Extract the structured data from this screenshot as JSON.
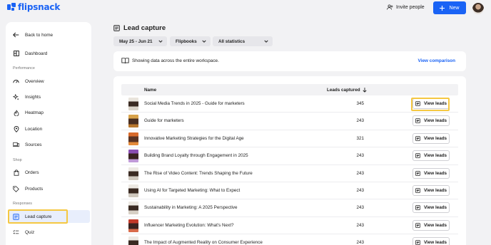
{
  "app": {
    "logo_text": "flipsnack",
    "brand_color": "#1a63f5",
    "highlight_color": "#f5c842"
  },
  "header": {
    "invite_label": "Invite people",
    "new_label": "New"
  },
  "sidebar": {
    "back_label": "Back to home",
    "dashboard_label": "Dashboard",
    "sections": {
      "performance": "Performance",
      "shop": "Shop",
      "responses": "Responses"
    },
    "items": [
      {
        "label": "Overview",
        "icon": "gauge-icon"
      },
      {
        "label": "Insights",
        "icon": "sparkle-icon"
      },
      {
        "label": "Heatmap",
        "icon": "flame-icon"
      },
      {
        "label": "Location",
        "icon": "pin-icon"
      },
      {
        "label": "Sources",
        "icon": "devices-icon"
      },
      {
        "label": "Orders",
        "icon": "bag-icon"
      },
      {
        "label": "Products",
        "icon": "tag-icon"
      },
      {
        "label": "Lead capture",
        "icon": "form-icon",
        "active": true
      },
      {
        "label": "Quiz",
        "icon": "quiz-icon"
      }
    ]
  },
  "main": {
    "title": "Lead capture",
    "filters": {
      "date_range": "May 25 - Jun 21",
      "flipbooks": "Flipbooks",
      "statistics": "All statistics"
    },
    "info_text": "Showing data across the entire workspace.",
    "view_comparison": "View comparison",
    "table": {
      "columns": {
        "name": "Name",
        "leads": "Leads captured"
      },
      "view_leads_label": "View leads",
      "rows": [
        {
          "name": "Social Media Trends in 2025 - Guide for marketers",
          "leads": "345"
        },
        {
          "name": "Guide for marketers",
          "leads": "243"
        },
        {
          "name": "Innovative Marketing Strategies for the Digital Age",
          "leads": "321"
        },
        {
          "name": "Building Brand Loyalty through Engagement in 2025",
          "leads": "243"
        },
        {
          "name": "The Rise of Video Content: Trends Shaping the Future",
          "leads": "243"
        },
        {
          "name": "Using AI for Targeted Marketing: What to Expect",
          "leads": "243"
        },
        {
          "name": "Sustainability in Marketing: A 2025 Perspective",
          "leads": "243"
        },
        {
          "name": "Influencer Marketing Evolution: What's Next?",
          "leads": "243"
        },
        {
          "name": "The Impact of Augmented Reality on Consumer Experience",
          "leads": "243"
        }
      ]
    }
  }
}
